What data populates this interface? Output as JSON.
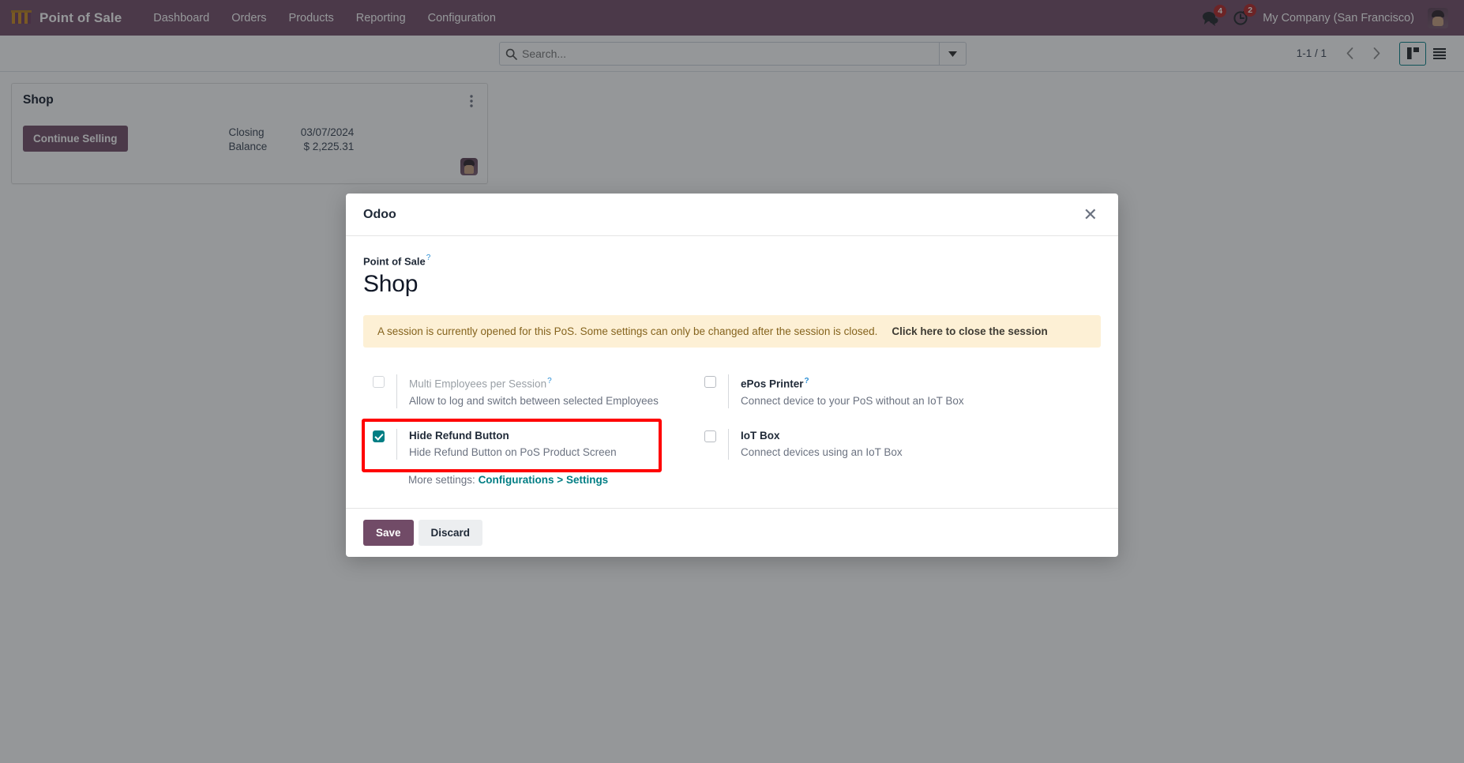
{
  "navbar": {
    "logo_icon": "pos-awning-icon",
    "brand": "Point of Sale",
    "menu": [
      {
        "label": "Dashboard"
      },
      {
        "label": "Orders"
      },
      {
        "label": "Products"
      },
      {
        "label": "Reporting"
      },
      {
        "label": "Configuration"
      }
    ],
    "messages_icon": "chat-bubble-icon",
    "messages_count": "4",
    "activities_icon": "clock-icon",
    "activities_count": "2",
    "company": "My Company (San Francisco)",
    "avatar_icon": "user-avatar",
    "bg_color": "#714B67"
  },
  "control_panel": {
    "search_icon": "search-icon",
    "search_value": "",
    "search_placeholder": "Search...",
    "search_dropdown_icon": "caret-down-icon",
    "pager": "1-1 / 1",
    "prev_icon": "chevron-left-icon",
    "next_icon": "chevron-right-icon",
    "kanban_view_icon": "kanban-view-icon",
    "list_view_icon": "list-view-icon",
    "active_view": "kanban",
    "active_view_color": "#017E84"
  },
  "kanban": {
    "card": {
      "title": "Shop",
      "menu_icon": "vertical-dots-icon",
      "primary_button": "Continue Selling",
      "stat_label_line1": "Closing",
      "stat_label_line2": "Balance",
      "stat_value_line1": "03/07/2024",
      "stat_value_line2": "$ 2,225.31",
      "avatar_icon": "user-avatar"
    }
  },
  "modal": {
    "title": "Odoo",
    "close_icon": "close-icon",
    "breadcrumb": "Point of Sale",
    "breadcrumb_help_icon": "help-question-icon",
    "record_title": "Shop",
    "alert": {
      "text": "A session is currently opened for this PoS. Some settings can only be changed after the session is closed.",
      "link": "Click here to close the session",
      "bg_color": "#fdf0d5",
      "text_color": "#85631d"
    },
    "settings": [
      {
        "label": "Multi Employees per Session",
        "help_icon": "help-question-icon",
        "has_help": true,
        "description": "Allow to log and switch between selected Employees",
        "checked": false,
        "disabled": true
      },
      {
        "label": "ePos Printer",
        "help_icon": "help-question-icon",
        "has_help": true,
        "description": "Connect device to your PoS without an IoT Box",
        "checked": false,
        "disabled": false
      },
      {
        "label": "Hide Refund Button",
        "help_icon": "",
        "has_help": false,
        "description": "Hide Refund Button on PoS Product Screen",
        "checked": true,
        "disabled": false
      },
      {
        "label": "IoT Box",
        "help_icon": "",
        "has_help": false,
        "description": "Connect devices using an IoT Box",
        "checked": false,
        "disabled": false
      }
    ],
    "more_settings_prefix": "More settings:",
    "more_settings_link": "Configurations > Settings",
    "save_label": "Save",
    "discard_label": "Discard",
    "save_color": "#714B67"
  },
  "annotation": {
    "highlight_color": "#ff0000",
    "highlight_target": "Hide Refund Button"
  }
}
